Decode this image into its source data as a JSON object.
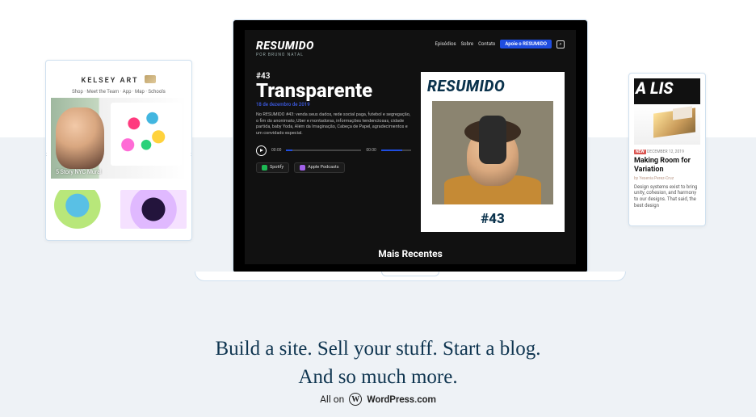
{
  "slides": {
    "left": {
      "logo": "KELSEY ART",
      "nav": "Shop · Meet the Team · App · Map · Schools",
      "hero_caption": "5 Story NYC Mural"
    },
    "center": {
      "brand": "RESUMIDO",
      "brand_sub": "POR BRUNO NATAL",
      "menu": {
        "m1": "Episódios",
        "m2": "Sobre",
        "m3": "Contato",
        "cta": "Apoie o RESUMIDO"
      },
      "episode_no": "#43",
      "episode_title": "Transparente",
      "episode_date": "18 de dezembro de 2019",
      "episode_desc": "No RESUMIDO #43: venda seus dados, rede social paga, futebol e segregação, o fim do anonimato, Uber e montadoras, informações tendenciosas, cidade partida, baby Yoda, Além da Imaginação, Cabeça de Papel, agradecimentos e um convidado especial.",
      "time_start": "00:00",
      "time_end": "00:00",
      "badge1": "Spotify",
      "badge2": "Apple Podcasts",
      "card_title": "RESUMIDO",
      "card_num": "#43",
      "recent": "Mais Recentes"
    },
    "right": {
      "stripe": "A LIS",
      "new_label": "NEW",
      "date": "DECEMBER 12, 2019",
      "title": "Making Room for Variation",
      "byline": "by Yesenia Perez-Cruz",
      "body": "Design systems exist to bring unity, cohesion, and harmony to our designs. That said, the best design"
    }
  },
  "headline": {
    "l1": "Build a site. Sell your stuff. Start a blog.",
    "l2": "And so much more."
  },
  "footer": {
    "prefix": "All on",
    "brand": "WordPress.com"
  }
}
